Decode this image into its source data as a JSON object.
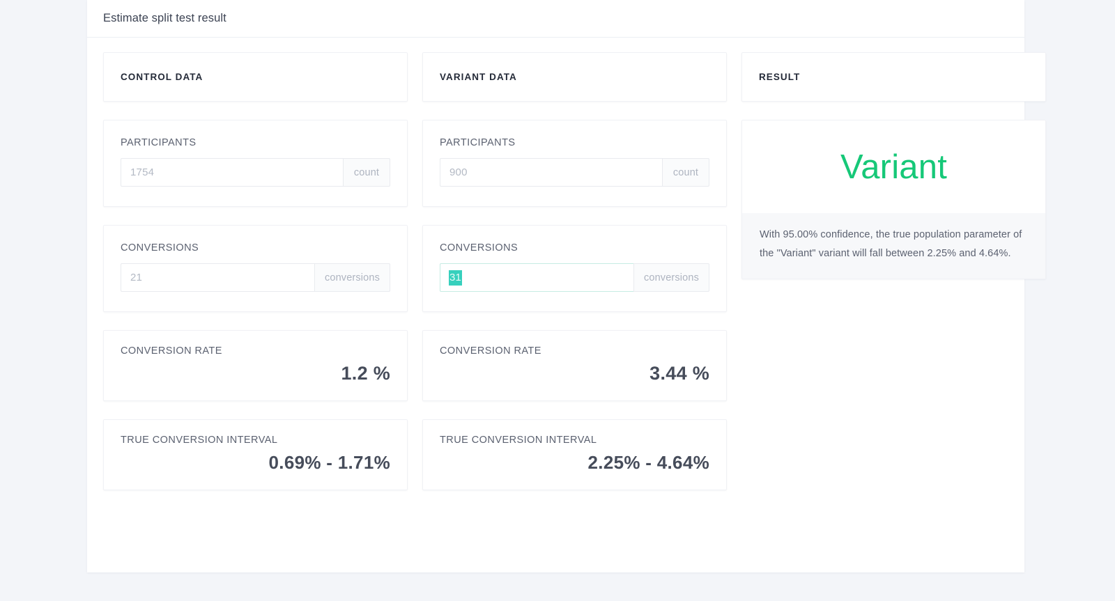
{
  "panel": {
    "title": "Estimate split test result"
  },
  "columns": {
    "control": {
      "header": "CONTROL DATA",
      "participants": {
        "label": "PARTICIPANTS",
        "value": "1754",
        "suffix": "count"
      },
      "conversions": {
        "label": "CONVERSIONS",
        "value": "21",
        "suffix": "conversions"
      },
      "conversion_rate": {
        "label": "CONVERSION RATE",
        "value": "1.2 %"
      },
      "true_conversion_interval": {
        "label": "TRUE CONVERSION INTERVAL",
        "value": "0.69% - 1.71%"
      }
    },
    "variant": {
      "header": "VARIANT DATA",
      "participants": {
        "label": "PARTICIPANTS",
        "value": "900",
        "suffix": "count"
      },
      "conversions": {
        "label": "CONVERSIONS",
        "value": "31",
        "suffix": "conversions"
      },
      "conversion_rate": {
        "label": "CONVERSION RATE",
        "value": "3.44 %"
      },
      "true_conversion_interval": {
        "label": "TRUE CONVERSION INTERVAL",
        "value": "2.25% - 4.64%"
      }
    },
    "result": {
      "header": "RESULT",
      "winner": "Variant",
      "explanation": "With 95.00% confidence, the true population parameter of the \"Variant\" variant will fall between 2.25% and 4.64%."
    }
  },
  "colors": {
    "page_background": "#f3f5f9",
    "winner_green": "#16c878",
    "selection_teal": "#37d0bd",
    "focus_border": "#c6ece3",
    "text_dark": "#242a38",
    "text_muted": "#5b6170",
    "placeholder": "#b3b9c4"
  }
}
